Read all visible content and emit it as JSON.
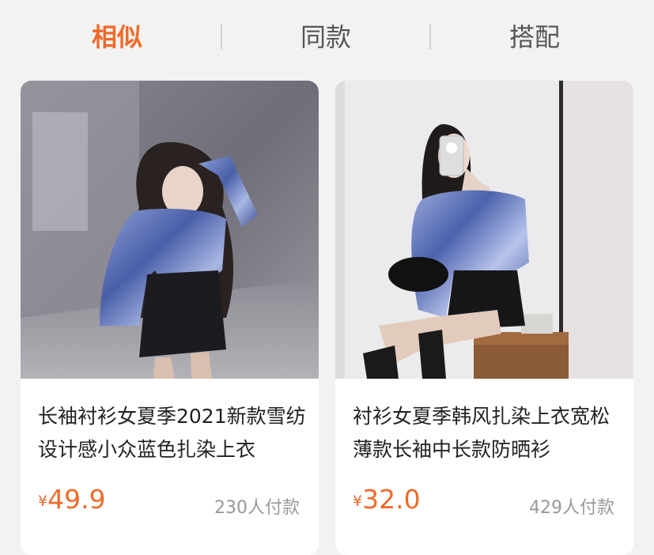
{
  "tabs": [
    {
      "label": "相似",
      "active": true
    },
    {
      "label": "同款",
      "active": false
    },
    {
      "label": "搭配",
      "active": false
    }
  ],
  "products": [
    {
      "title": "长袖衬衫女夏季2021新款雪纺设计感小众蓝色扎染上衣",
      "currency": "¥",
      "price": "49.9",
      "sold": "230人付款"
    },
    {
      "title": "衬衫女夏季韩风扎染上衣宽松薄款长袖中长款防晒衫",
      "currency": "¥",
      "price": "32.0",
      "sold": "429人付款"
    }
  ],
  "colors": {
    "accent": "#ef6a2a",
    "background": "#f2f2f2",
    "muted_text": "#999999"
  }
}
